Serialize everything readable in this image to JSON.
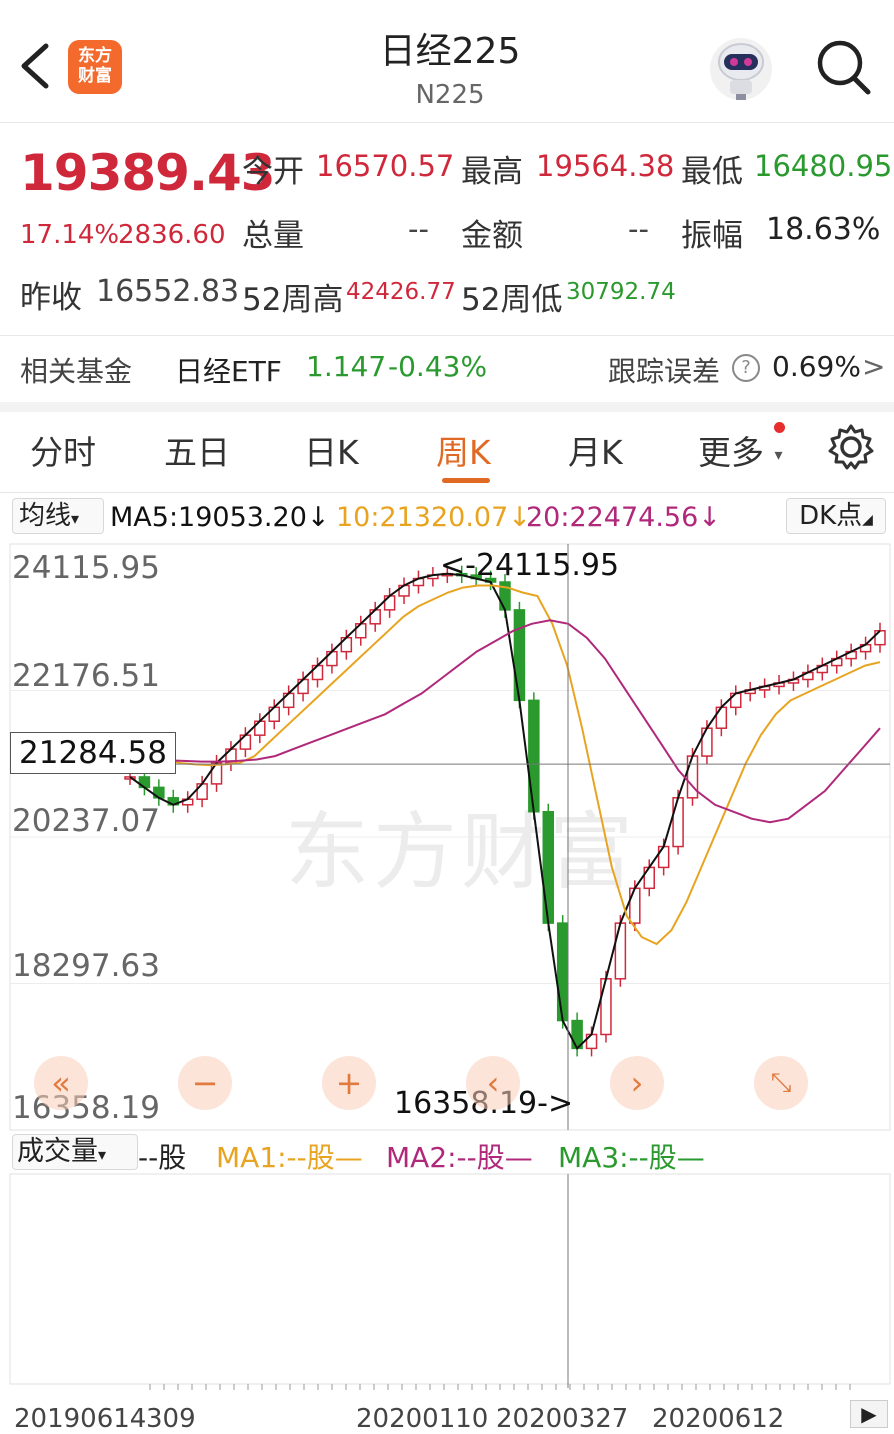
{
  "header": {
    "logo_text_top": "东方",
    "logo_text_bottom": "财富",
    "title": "日经225",
    "subtitle": "N225"
  },
  "quote": {
    "price": "19389.43",
    "change_pct": "17.14%",
    "change_val": "2836.60",
    "open_label": "今开",
    "open": "16570.57",
    "high_label": "最高",
    "high": "19564.38",
    "low_label": "最低",
    "low": "16480.95",
    "volume_label": "总量",
    "volume": "--",
    "amount_label": "金额",
    "amount": "--",
    "amplitude_label": "振幅",
    "amplitude": "18.63%",
    "prev_close_label": "昨收",
    "prev_close": "16552.83",
    "wk52_high_label": "52周高",
    "wk52_high": "42426.77",
    "wk52_low_label": "52周低",
    "wk52_low": "30792.74"
  },
  "fund": {
    "label": "相关基金",
    "name": "日经ETF",
    "price": "1.147",
    "change": "-0.43%",
    "tracking_label": "跟踪误差",
    "tracking_value": "0.69%",
    "arrow": ">"
  },
  "tabs": [
    "分时",
    "五日",
    "日K",
    "周K",
    "月K",
    "更多"
  ],
  "active_tab": "周K",
  "ma_legend": {
    "selector": "均线",
    "ma5": "MA5:19053.20",
    "ma10": "10:21320.07",
    "ma20": "20:22474.56",
    "down_arrow": "↓",
    "dk_button": "DK点"
  },
  "colors": {
    "up": "#d0283b",
    "down": "#2a9a2f",
    "ma5": "#111111",
    "ma10": "#e8a420",
    "ma20": "#b0287a",
    "accent": "#e06a24"
  },
  "chart_data": {
    "type": "candlestick",
    "y_ticks": [
      "24115.95",
      "22176.51",
      "20237.07",
      "18297.63",
      "16358.19"
    ],
    "ylim": [
      16358.19,
      24115.95
    ],
    "crosshair_price": "21284.58",
    "max_label": "<-24115.95",
    "min_label": "16358.19->",
    "x_ticks": [
      "20190614",
      "309",
      "20200110",
      "20200327",
      "20200612"
    ],
    "series": [
      {
        "name": "MA5",
        "values": [
          21100,
          20950,
          20800,
          20700,
          20780,
          21000,
          21300,
          21500,
          21700,
          21900,
          22100,
          22300,
          22500,
          22700,
          22900,
          23100,
          23300,
          23500,
          23700,
          23850,
          23950,
          24000,
          24020,
          24000,
          23950,
          23900,
          23500,
          22200,
          20600,
          19000,
          17600,
          17200,
          17400,
          18200,
          19000,
          19500,
          19800,
          20100,
          20800,
          21400,
          21800,
          22100,
          22300,
          22350,
          22400,
          22450,
          22500,
          22600,
          22700,
          22800,
          22900,
          23000,
          23200
        ]
      },
      {
        "name": "10",
        "values": [
          21350,
          21300,
          21280,
          21270,
          21280,
          21300,
          21400,
          21600,
          21800,
          22000,
          22200,
          22400,
          22600,
          22800,
          23000,
          23200,
          23400,
          23550,
          23650,
          23750,
          23820,
          23850,
          23850,
          23820,
          23750,
          23700,
          23300,
          22700,
          21800,
          20800,
          19800,
          19100,
          18800,
          18700,
          18900,
          19300,
          19800,
          20300,
          20800,
          21300,
          21700,
          22000,
          22200,
          22300,
          22400,
          22500,
          22600,
          22700,
          22750
        ]
      },
      {
        "name": "20",
        "values": [
          21340,
          21330,
          21320,
          21320,
          21330,
          21350,
          21400,
          21500,
          21600,
          21700,
          21800,
          21900,
          22000,
          22150,
          22300,
          22500,
          22700,
          22900,
          23050,
          23200,
          23300,
          23350,
          23300,
          23100,
          22800,
          22400,
          22000,
          21600,
          21200,
          20900,
          20700,
          20600,
          20500,
          20450,
          20500,
          20700,
          20900,
          21200,
          21500,
          21800
        ]
      }
    ]
  },
  "volume": {
    "selector": "成交量",
    "value": "--股",
    "ma1": "MA1:--股—",
    "ma2": "MA2:--股—",
    "ma3": "MA3:--股—"
  }
}
